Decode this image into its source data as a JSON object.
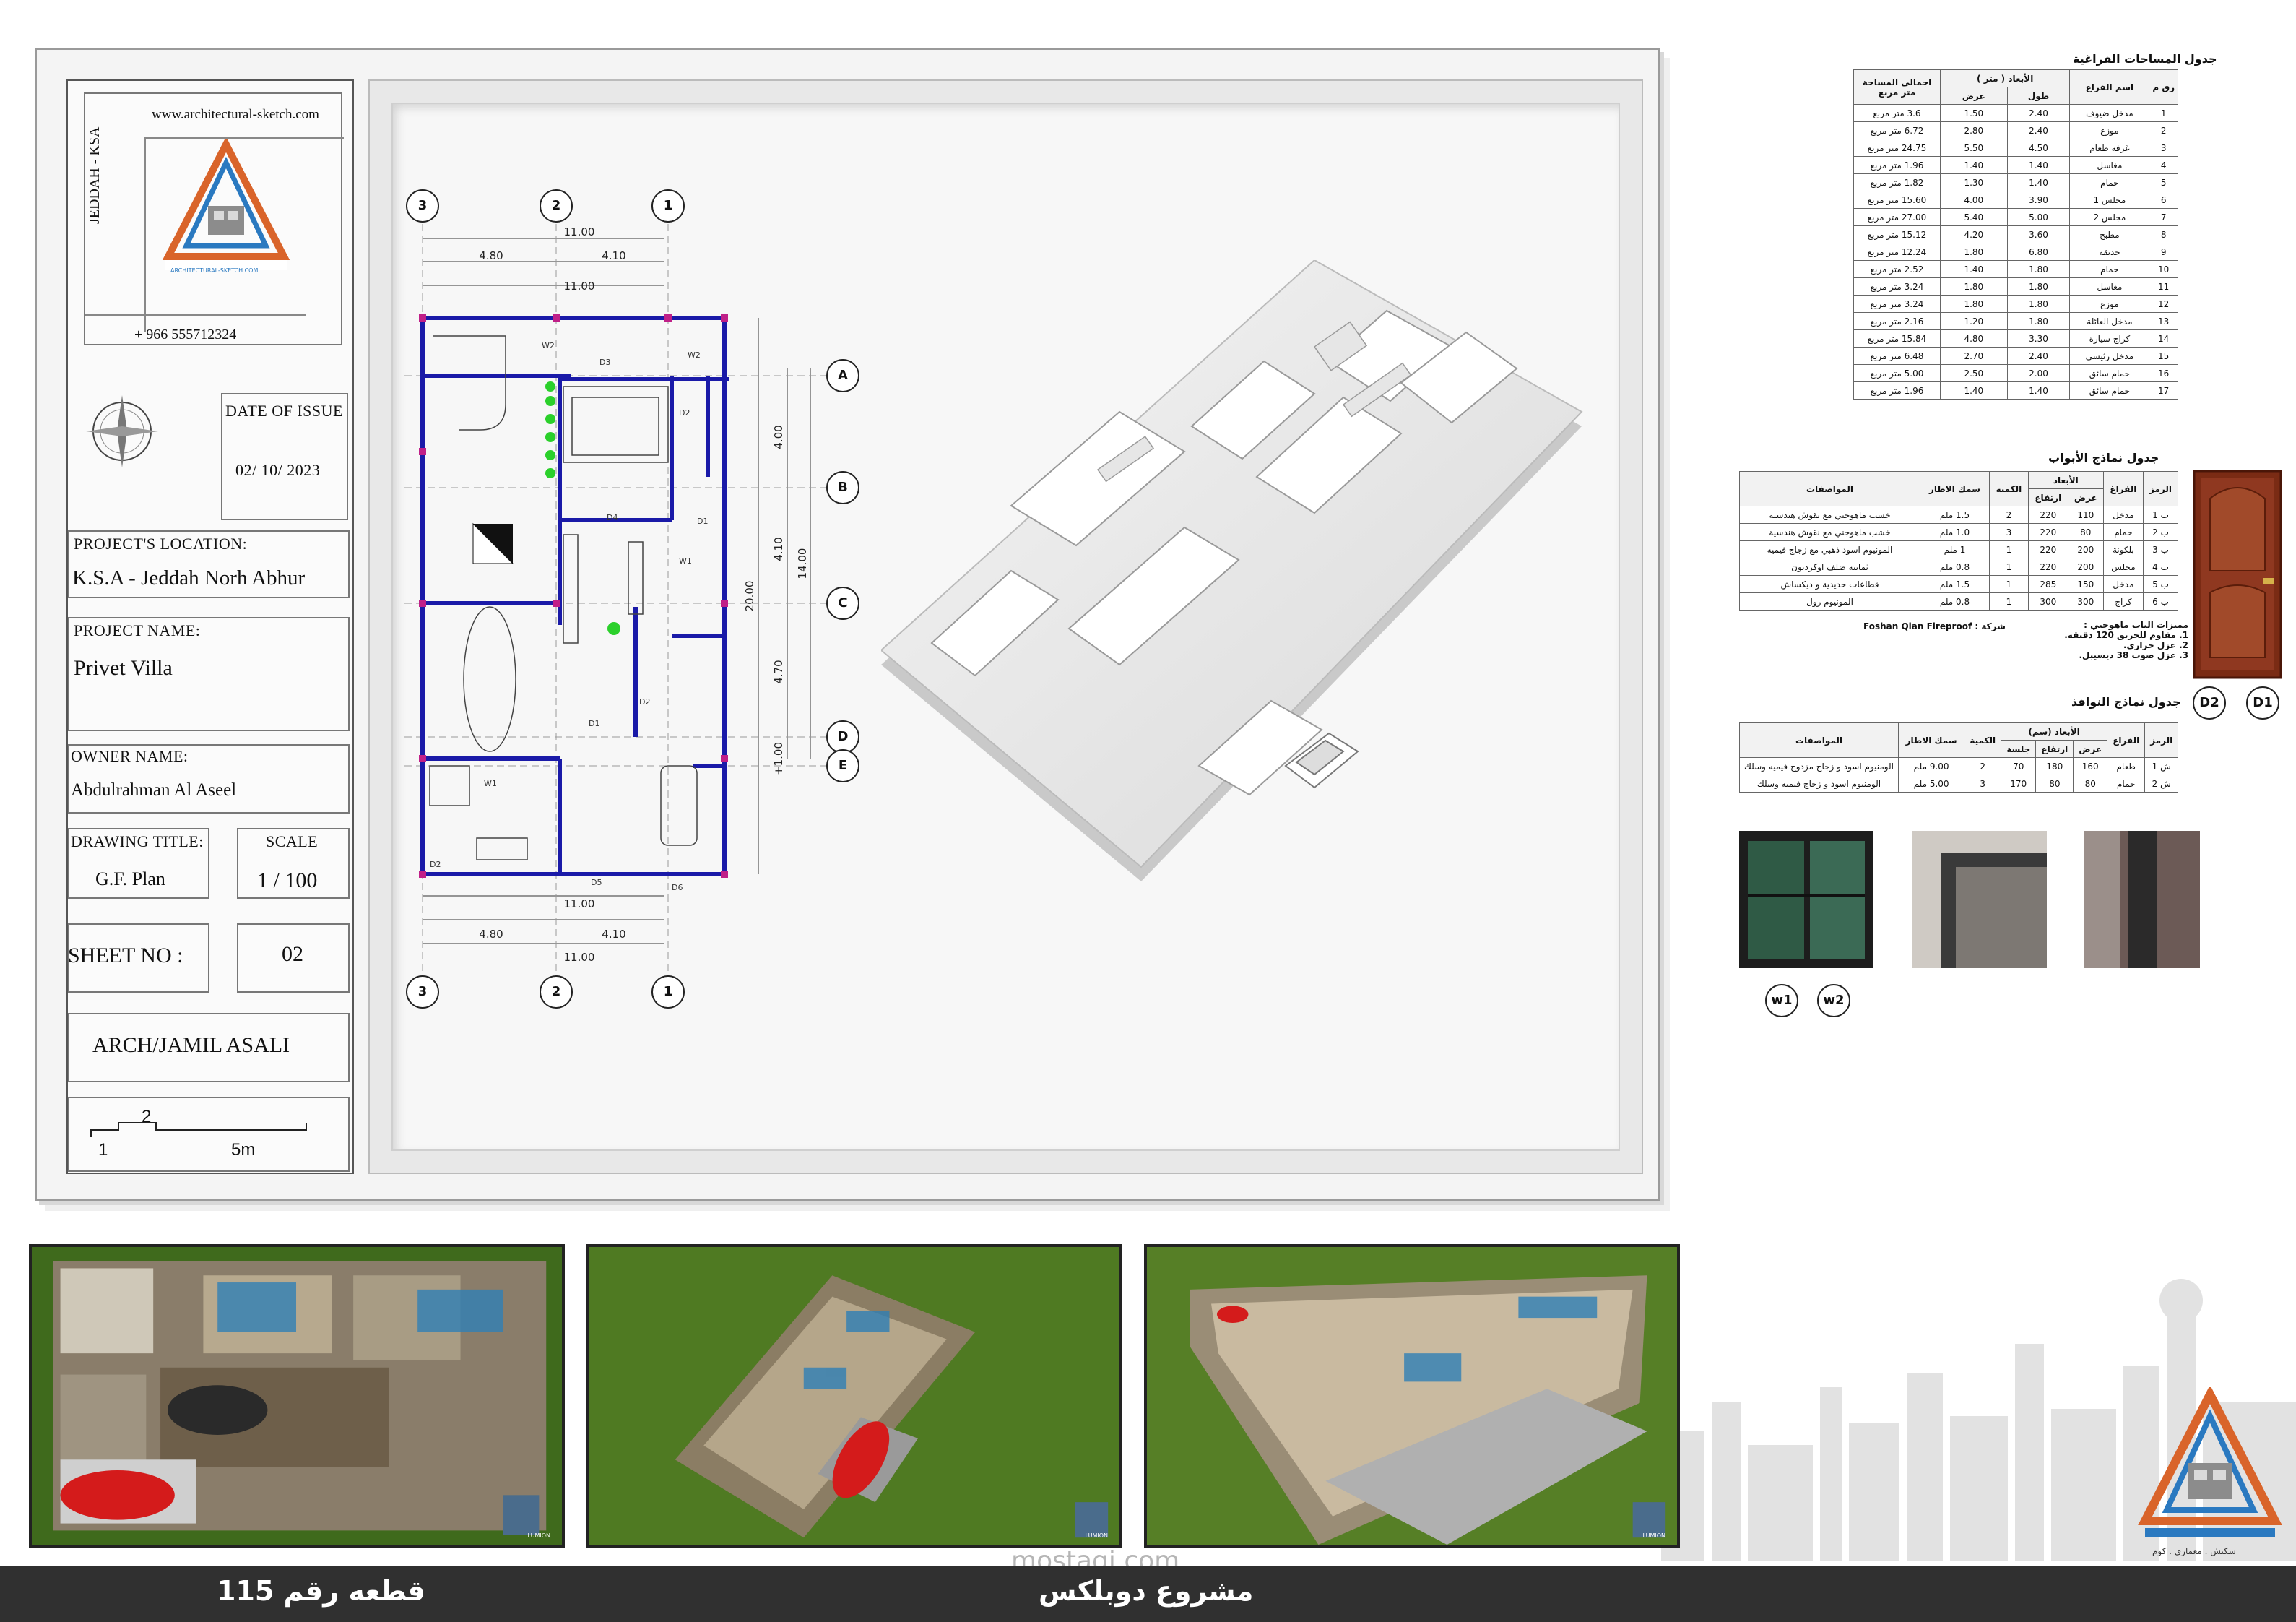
{
  "titleblock": {
    "website": "www.architectural-sketch.com",
    "city_vertical": "JEDDAH - KSA",
    "phone": "+ 966 555712324",
    "logo_text": "ARCHITECTURAL-SKETCH.COM",
    "logo_sub": "سكتش . معماري . كوم",
    "date_label": "DATE OF ISSUE",
    "date_value": "02/ 10/ 2023",
    "location_label": "PROJECT'S LOCATION:",
    "location_value": "K.S.A - Jeddah Norh Abhur",
    "project_label": "PROJECT NAME:",
    "project_value": "Privet Villa",
    "owner_label": "OWNER NAME:",
    "owner_value": "Abdulrahman Al Aseel",
    "drawing_label": "DRAWING TITLE:",
    "drawing_value": "G.F. Plan",
    "scale_label": "SCALE",
    "scale_value": "1 / 100",
    "sheet_label": "SHEET NO :",
    "sheet_value": "02",
    "architect": "ARCH/JAMIL ASALI",
    "scalebar_1": "1",
    "scalebar_2": "2",
    "scalebar_5": "5m"
  },
  "plan": {
    "grid_cols": [
      "3",
      "2",
      "1"
    ],
    "grid_rows": [
      "A",
      "B",
      "C",
      "D",
      "E"
    ],
    "dims_top": {
      "total": "11.00",
      "left": "4.80",
      "right": "4.10"
    },
    "dims_side": {
      "ab": "4.00",
      "bc": "4.10",
      "cd": "4.70",
      "de": "+1.00",
      "sub": "14.00",
      "total": "20.00"
    },
    "tags": [
      "W2",
      "D3",
      "W2",
      "D2",
      "D4",
      "D1",
      "W1",
      "D2",
      "D1",
      "W1",
      "D2",
      "D5",
      "D6"
    ]
  },
  "spaces_table": {
    "title": "جدول المساحات الفراغية",
    "headers": {
      "no": "رق م",
      "space": "اسم الفراغ",
      "dims": "الأبعاد ( متر )",
      "length": "طول",
      "width": "عرض",
      "area": "اجمالي المساحة متر مربع"
    },
    "rows": [
      {
        "no": "1",
        "space": "مدخل ضيوف",
        "length": "2.40",
        "width": "1.50",
        "area": "3.6 متر مربع"
      },
      {
        "no": "2",
        "space": "موزع",
        "length": "2.40",
        "width": "2.80",
        "area": "6.72 متر مربع"
      },
      {
        "no": "3",
        "space": "غرفة طعام",
        "length": "4.50",
        "width": "5.50",
        "area": "24.75 متر مربع"
      },
      {
        "no": "4",
        "space": "مغاسل",
        "length": "1.40",
        "width": "1.40",
        "area": "1.96 متر مربع"
      },
      {
        "no": "5",
        "space": "حمام",
        "length": "1.40",
        "width": "1.30",
        "area": "1.82 متر مربع"
      },
      {
        "no": "6",
        "space": "مجلس 1",
        "length": "3.90",
        "width": "4.00",
        "area": "15.60 متر مربع"
      },
      {
        "no": "7",
        "space": "مجلس 2",
        "length": "5.00",
        "width": "5.40",
        "area": "27.00 متر مربع"
      },
      {
        "no": "8",
        "space": "مطبخ",
        "length": "3.60",
        "width": "4.20",
        "area": "15.12 متر مربع"
      },
      {
        "no": "9",
        "space": "حديقة",
        "length": "6.80",
        "width": "1.80",
        "area": "12.24 متر مربع"
      },
      {
        "no": "10",
        "space": "حمام",
        "length": "1.80",
        "width": "1.40",
        "area": "2.52 متر مربع"
      },
      {
        "no": "11",
        "space": "مغاسل",
        "length": "1.80",
        "width": "1.80",
        "area": "3.24 متر مربع"
      },
      {
        "no": "12",
        "space": "موزع",
        "length": "1.80",
        "width": "1.80",
        "area": "3.24 متر مربع"
      },
      {
        "no": "13",
        "space": "مدخل العائلة",
        "length": "1.80",
        "width": "1.20",
        "area": "2.16 متر مربع"
      },
      {
        "no": "14",
        "space": "كراج سيارة",
        "length": "3.30",
        "width": "4.80",
        "area": "15.84 متر مربع"
      },
      {
        "no": "15",
        "space": "مدخل رئيسي",
        "length": "2.40",
        "width": "2.70",
        "area": "6.48 متر مربع"
      },
      {
        "no": "16",
        "space": "حمام سائق",
        "length": "2.00",
        "width": "2.50",
        "area": "5.00 متر مربع"
      },
      {
        "no": "17",
        "space": "حمام سائق",
        "length": "1.40",
        "width": "1.40",
        "area": "1.96 متر مربع"
      }
    ]
  },
  "doors_table": {
    "title": "جدول نماذج الأبواب",
    "headers": {
      "code": "الرمز",
      "space": "الفراغ",
      "dims": "الأبعاد",
      "width": "عرض",
      "height": "ارتفاع",
      "qty": "الكمية",
      "thick": "سمك الاطار",
      "spec": "المواصفات"
    },
    "rows": [
      {
        "code": "ب 1",
        "space": "مدخل",
        "width": "110",
        "height": "220",
        "qty": "2",
        "thick": "1.5 ملم",
        "spec": "خشب ماهوجني مع نقوش هندسية"
      },
      {
        "code": "ب 2",
        "space": "حمام",
        "width": "80",
        "height": "220",
        "qty": "3",
        "thick": "1.0 ملم",
        "spec": "خشب ماهوجني مع نقوش هندسية"
      },
      {
        "code": "ب 3",
        "space": "بلكونة",
        "width": "200",
        "height": "220",
        "qty": "1",
        "thick": "1 ملم",
        "spec": "المونيوم اسود ذهبي مع زجاج فيميه"
      },
      {
        "code": "ب 4",
        "space": "مجلس",
        "width": "200",
        "height": "220",
        "qty": "1",
        "thick": "0.8 ملم",
        "spec": "ثمانية ضلف اوكرديون"
      },
      {
        "code": "ب 5",
        "space": "مدخل",
        "width": "150",
        "height": "285",
        "qty": "1",
        "thick": "1.5 ملم",
        "spec": "قطاعات حديدية و ديكساش"
      },
      {
        "code": "ب 6",
        "space": "كراج",
        "width": "300",
        "height": "300",
        "qty": "1",
        "thick": "0.8 ملم",
        "spec": "المونيوم رول"
      }
    ],
    "notes_title": "مميزات الباب ماهوجني :",
    "notes": [
      "1. مقاوم للحريق 120 دقيقة.",
      "2. عزل حراري.",
      "3. عزل صوت 38 ديسيبل."
    ],
    "brand": "Foshan Qian Fireproof : شركة",
    "door_labels": [
      "D2",
      "D1"
    ]
  },
  "windows_table": {
    "title": "جدول نماذج النوافذ",
    "headers": {
      "code": "الرمز",
      "space": "الفراغ",
      "dims": "الأبعاد (سم)",
      "width": "عرض",
      "height": "ارتفاع",
      "sill": "جلسة",
      "qty": "الكمية",
      "thick": "سمك الاطار",
      "spec": "المواصفات"
    },
    "rows": [
      {
        "code": "ش 1",
        "space": "طعام",
        "width": "160",
        "height": "180",
        "sill": "70",
        "qty": "2",
        "thick": "9.00 ملم",
        "spec": "الومنيوم اسود و زجاج مزدوج فيميه وسلك"
      },
      {
        "code": "ش 2",
        "space": "حمام",
        "width": "80",
        "height": "80",
        "sill": "170",
        "qty": "3",
        "thick": "5.00 ملم",
        "spec": "الومنيوم اسود و زجاج فيميه وسلك"
      }
    ],
    "window_labels": [
      "w1",
      "w2"
    ]
  },
  "watermark": "mostaqi.com",
  "bottom_logo_sub": "سكتش . معماري . كوم",
  "render_badge": "LUMION",
  "footer": {
    "left": "قطعه رقم 115",
    "center": "مشروع دوبلكس"
  },
  "colors": {
    "footer": "#303030",
    "wall": "#1a1aa8",
    "grass": "#3f6a1c",
    "car": "#d41b1b"
  }
}
